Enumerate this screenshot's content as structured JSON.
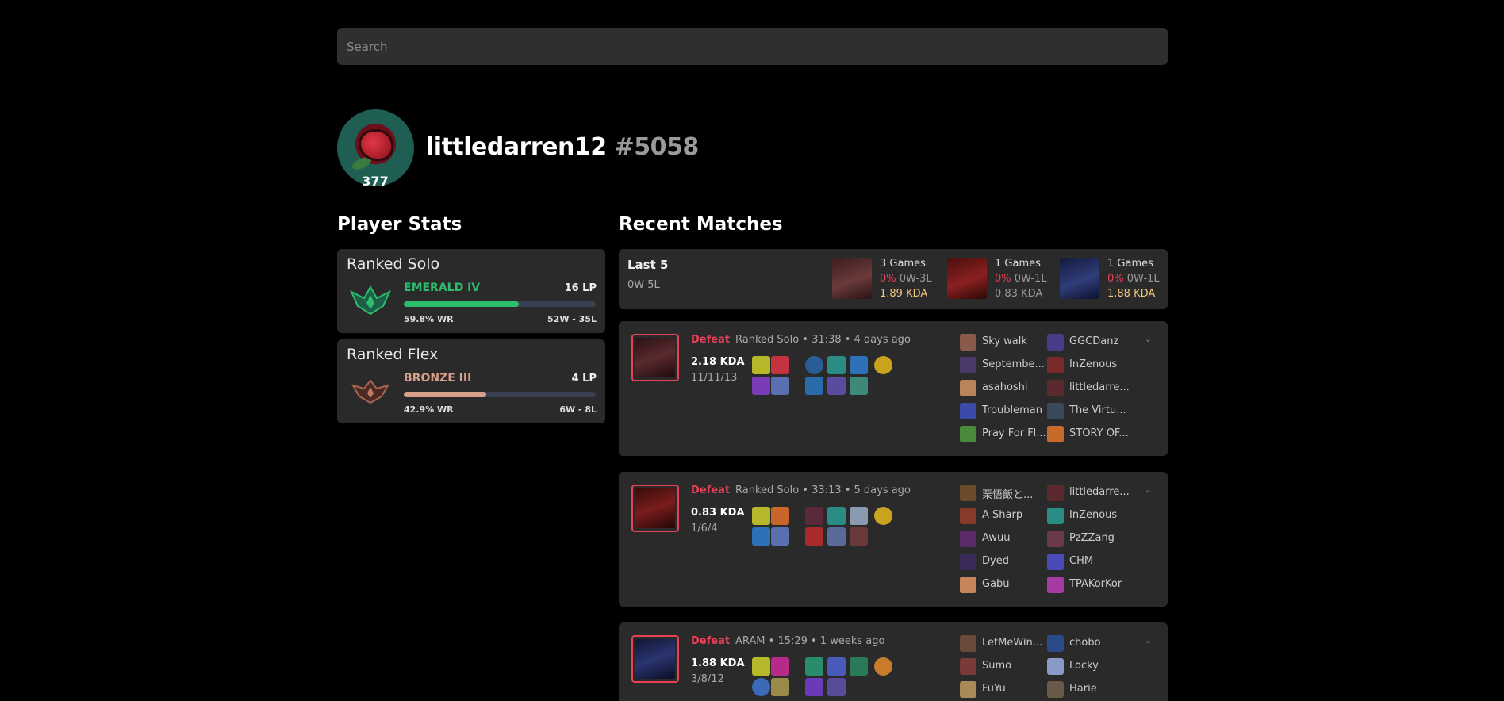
{
  "search": {
    "placeholder": "Search"
  },
  "profile": {
    "level": "377",
    "name": "littledarren12",
    "tag": "#5058"
  },
  "sections": {
    "player_stats": "Player Stats",
    "recent_matches": "Recent Matches"
  },
  "ranked": [
    {
      "title": "Ranked Solo",
      "tier": "EMERALD IV",
      "lp": "16 LP",
      "winrate": "59.8% WR",
      "record": "52W - 35L",
      "progress_percent": 59.8,
      "color": "#2dbd6f",
      "icon": "emerald-emblem-icon"
    },
    {
      "title": "Ranked Flex",
      "tier": "BRONZE III",
      "lp": "4 LP",
      "winrate": "42.9% WR",
      "record": "6W - 8L",
      "progress_percent": 42.9,
      "color": "#d6a08a",
      "icon": "bronze-emblem-icon"
    }
  ],
  "last5": {
    "title": "Last 5",
    "record": "0W-5L",
    "champions": [
      {
        "games": "3 Games",
        "pct": "0%",
        "wl": "0W-3L",
        "kda": "1.89 KDA",
        "kda_color": "#f3c97b",
        "color": "#6b3a3a",
        "icon": "champion-portrait-icon"
      },
      {
        "games": "1 Games",
        "pct": "0%",
        "wl": "0W-1L",
        "kda": "0.83 KDA",
        "kda_color": "#9a9a9a",
        "color": "#8a2020",
        "icon": "champion-portrait-icon"
      },
      {
        "games": "1 Games",
        "pct": "0%",
        "wl": "0W-1L",
        "kda": "1.88 KDA",
        "kda_color": "#f3c97b",
        "color": "#2f3d7a",
        "icon": "champion-portrait-icon"
      }
    ]
  },
  "matches": [
    {
      "result": "Defeat",
      "meta": "Ranked Solo • 31:38 • 4 days ago",
      "kda": "2.18 KDA",
      "score": "11/11/13",
      "champ_color": "#5a2a2e",
      "players_left": [
        "Sky walk",
        "Septembe...",
        "asahoshi",
        "Troubleman",
        "Pray For Fl..."
      ],
      "players_right": [
        "GGCDanz",
        "InZenous",
        "littledarre...",
        "The Virtu...",
        "STORY OF..."
      ]
    },
    {
      "result": "Defeat",
      "meta": "Ranked Solo • 33:13 • 5 days ago",
      "kda": "0.83 KDA",
      "score": "1/6/4",
      "champ_color": "#7a1c1c",
      "players_left": [
        "栗悟飯と...",
        "A Sharp",
        "Awuu",
        "Dyed",
        "Gabu"
      ],
      "players_right": [
        "littledarre...",
        "InZenous",
        "PzZZang",
        "CHM",
        "TPAKorKor"
      ]
    },
    {
      "result": "Defeat",
      "meta": "ARAM • 15:29 • 1 weeks ago",
      "kda": "1.88 KDA",
      "score": "3/8/12",
      "champ_color": "#2a3570",
      "players_left": [
        "LetMeWin...",
        "Sumo",
        "FuYu"
      ],
      "players_right": [
        "chobo",
        "Locky",
        "Harie"
      ]
    }
  ]
}
